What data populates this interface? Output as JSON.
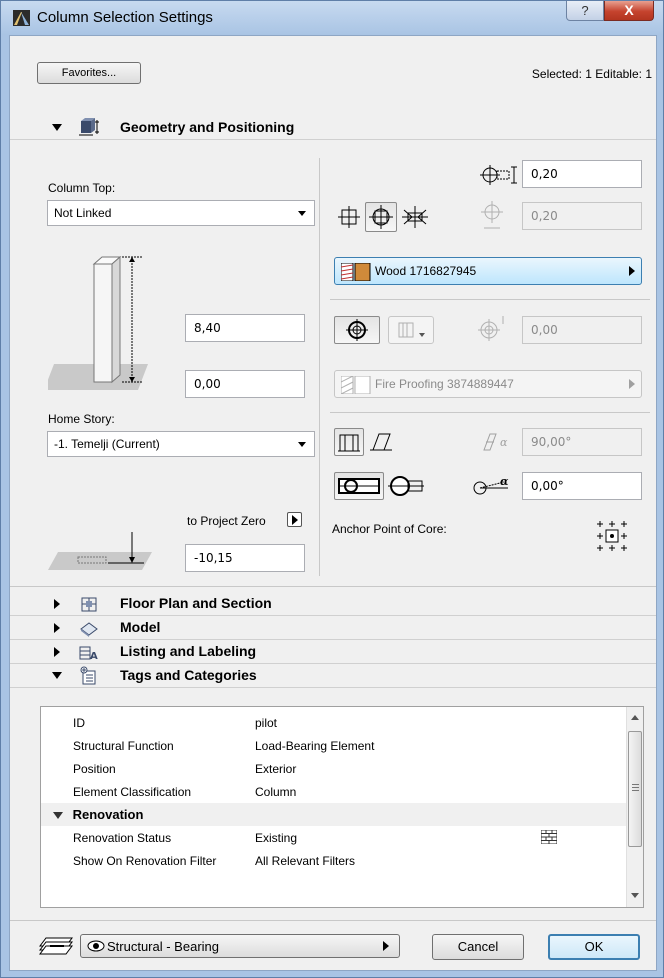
{
  "window": {
    "title": "Column Selection Settings",
    "help_glyph": "?",
    "close_glyph": "X"
  },
  "header": {
    "favorites_label": "Favorites...",
    "selection_status": "Selected: 1 Editable: 1"
  },
  "panels": {
    "geometry": "Geometry and Positioning",
    "floor_plan": "Floor Plan and Section",
    "model": "Model",
    "listing": "Listing and Labeling",
    "tags": "Tags and Categories"
  },
  "geometry": {
    "column_top_label": "Column Top:",
    "column_top_value": "Not Linked",
    "height_value": "8,40",
    "bottom_offset_value": "0,00",
    "home_story_label": "Home Story:",
    "home_story_value": "-1. Temelji (Current)",
    "to_project_zero_label": "to Project Zero",
    "project_zero_value": "-10,15",
    "width_value": "0,20",
    "depth_value": "0,20",
    "core_material": "Wood 1716827945",
    "veneer_thickness": "0,00",
    "veneer_material": "Fire Proofing 3874889447",
    "slant_angle": "90,00°",
    "rotation_angle": "0,00°",
    "anchor_point_label": "Anchor Point of Core:"
  },
  "properties": {
    "rows": [
      {
        "key": "ID",
        "value": "pilot"
      },
      {
        "key": "Structural Function",
        "value": "Load-Bearing Element"
      },
      {
        "key": "Position",
        "value": "Exterior"
      },
      {
        "key": "Element Classification",
        "value": "Column"
      }
    ],
    "renovation_group": "Renovation",
    "renovation_rows": [
      {
        "key": "Renovation Status",
        "value": "Existing"
      },
      {
        "key": "Show On Renovation Filter",
        "value": "All Relevant Filters"
      }
    ]
  },
  "footer": {
    "layer_value": "Structural - Bearing",
    "cancel_label": "Cancel",
    "ok_label": "OK"
  },
  "colors": {
    "wood": "#d08a3a",
    "accent": "#3c7fb1"
  }
}
